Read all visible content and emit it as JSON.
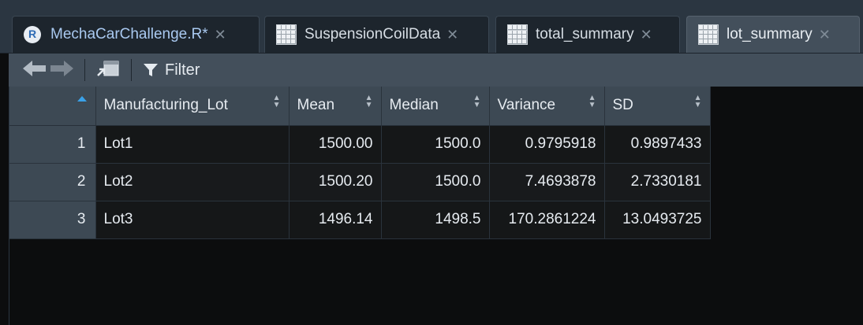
{
  "tabs": [
    {
      "label": "MechaCarChallenge.R*",
      "icon": "r-script-icon",
      "active": false
    },
    {
      "label": "SuspensionCoilData",
      "icon": "data-grid-icon",
      "active": false
    },
    {
      "label": "total_summary",
      "icon": "data-grid-icon",
      "active": false
    },
    {
      "label": "lot_summary",
      "icon": "data-grid-icon",
      "active": true
    }
  ],
  "toolbar": {
    "filter_label": "Filter"
  },
  "table": {
    "columns": [
      "Manufacturing_Lot",
      "Mean",
      "Median",
      "Variance",
      "SD"
    ],
    "rows": [
      {
        "n": "1",
        "cells": [
          "Lot1",
          "1500.00",
          "1500.0",
          "0.9795918",
          "0.9897433"
        ]
      },
      {
        "n": "2",
        "cells": [
          "Lot2",
          "1500.20",
          "1500.0",
          "7.4693878",
          "2.7330181"
        ]
      },
      {
        "n": "3",
        "cells": [
          "Lot3",
          "1496.14",
          "1498.5",
          "170.2861224",
          "13.0493725"
        ]
      }
    ]
  },
  "colors": {
    "tabbar": "#2b3641",
    "active_tab": "#434f5b",
    "header": "#3d4954",
    "sort_accent": "#3aa1e8",
    "background": "#0c0d0e"
  }
}
